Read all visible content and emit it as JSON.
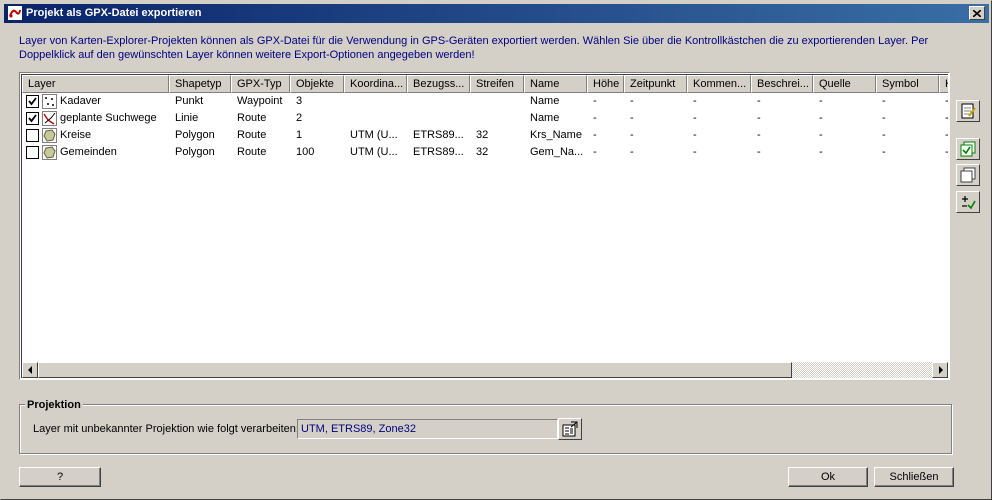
{
  "window": {
    "title": "Projekt als GPX-Datei exportieren",
    "description": "Layer von Karten-Explorer-Projekten können als GPX-Datei für die Verwendung in GPS-Geräten exportiert werden. Wählen Sie über die Kontrollkästchen die zu exportierenden Layer. Per Doppelklick auf den gewünschten Layer können weitere Export-Optionen angegeben werden!"
  },
  "table": {
    "columns": [
      "Layer",
      "Shapetyp",
      "GPX-Typ",
      "Objekte",
      "Koordina...",
      "Bezugss...",
      "Streifen",
      "Name",
      "Höhe",
      "Zeitpunkt",
      "Kommen...",
      "Beschrei...",
      "Quelle",
      "Symbol",
      "K"
    ],
    "rows": [
      {
        "checked": true,
        "icon": "points-layer-icon",
        "cells": [
          "Kadaver",
          "Punkt",
          "Waypoint",
          "3",
          "",
          "",
          "",
          "Name",
          "-",
          "-",
          "-",
          "-",
          "-",
          "-",
          "-"
        ]
      },
      {
        "checked": true,
        "icon": "lines-layer-icon",
        "cells": [
          "geplante Suchwege",
          "Linie",
          "Route",
          "2",
          "",
          "",
          "",
          "Name",
          "-",
          "-",
          "-",
          "-",
          "-",
          "-",
          "-"
        ]
      },
      {
        "checked": false,
        "icon": "polygon-layer-icon",
        "cells": [
          "Kreise",
          "Polygon",
          "Route",
          "1",
          "UTM (U...",
          "ETRS89...",
          "32",
          "Krs_Name",
          "-",
          "-",
          "-",
          "-",
          "-",
          "-",
          "-"
        ]
      },
      {
        "checked": false,
        "icon": "polygon-layer-icon",
        "cells": [
          "Gemeinden",
          "Polygon",
          "Route",
          "100",
          "UTM (U...",
          "ETRS89...",
          "32",
          "Gem_Na...",
          "-",
          "-",
          "-",
          "-",
          "-",
          "-",
          "-"
        ]
      }
    ]
  },
  "projection": {
    "group_label": "Projektion",
    "label": "Layer mit unbekannter Projektion wie folgt verarbeiten:",
    "value": "UTM, ETRS89, Zone32"
  },
  "buttons": {
    "help": "?",
    "ok": "Ok",
    "close": "Schließen"
  },
  "side_toolbar": [
    "edit-options-icon",
    "check-all-icon",
    "uncheck-all-icon",
    "toggle-check-icon"
  ],
  "colors": {
    "title_start": "#0a246a",
    "title_end": "#3a6ea5",
    "description_text": "#00007f",
    "dialog_bg": "#d4d0c8"
  }
}
